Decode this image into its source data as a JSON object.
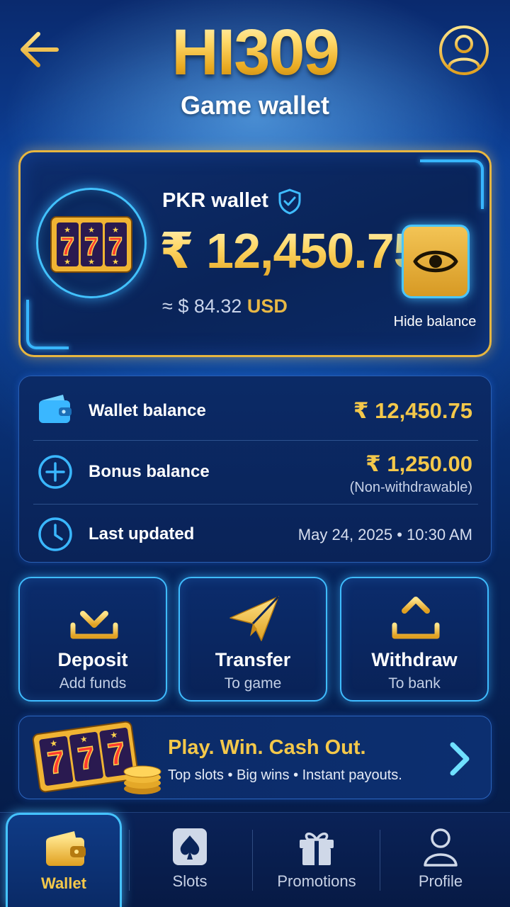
{
  "header": {
    "brand": "HI309",
    "subtitle": "Game wallet",
    "back_icon": "arrow-left-icon",
    "profile_icon": "user-circle-icon"
  },
  "wallet_card": {
    "wallet_name": "PKR wallet",
    "verified_icon": "shield-check-icon",
    "balance": "₹ 12,450.75",
    "usd_prefix": "≈ $ 84.32",
    "usd_currency": "USD",
    "hide_label": "Hide balance",
    "eye_icon": "eye-icon",
    "slot_icon": "slot-machine-777-icon"
  },
  "info": {
    "rows": [
      {
        "icon": "wallet-icon",
        "label": "Wallet balance",
        "value": "₹ 12,450.75"
      },
      {
        "icon": "plus-circle-icon",
        "label": "Bonus balance",
        "value": "₹ 1,250.00",
        "note": "(Non-withdrawable)"
      },
      {
        "icon": "clock-icon",
        "label": "Last updated",
        "value": "May 24, 2025 • 10:30 AM"
      }
    ]
  },
  "actions": [
    {
      "icon": "download-icon",
      "title": "Deposit",
      "subtitle": "Add funds"
    },
    {
      "icon": "paper-plane-icon",
      "title": "Transfer",
      "subtitle": "To game"
    },
    {
      "icon": "upload-icon",
      "title": "Withdraw",
      "subtitle": "To bank"
    }
  ],
  "promo": {
    "title": "Play. Win. Cash Out.",
    "subtitle": "Top slots • Big wins • Instant payouts.",
    "arrow_icon": "arrow-right-icon"
  },
  "nav": {
    "active": "Wallet",
    "items": [
      {
        "icon": "wallet-icon",
        "label": "Wallet"
      },
      {
        "icon": "spade-card-icon",
        "label": "Slots"
      },
      {
        "icon": "gift-icon",
        "label": "Promotions"
      },
      {
        "icon": "user-icon",
        "label": "Profile"
      }
    ]
  },
  "colors": {
    "gold": "#f4c84a",
    "accent_blue": "#3fbcff",
    "background": "#0a2a6e"
  }
}
